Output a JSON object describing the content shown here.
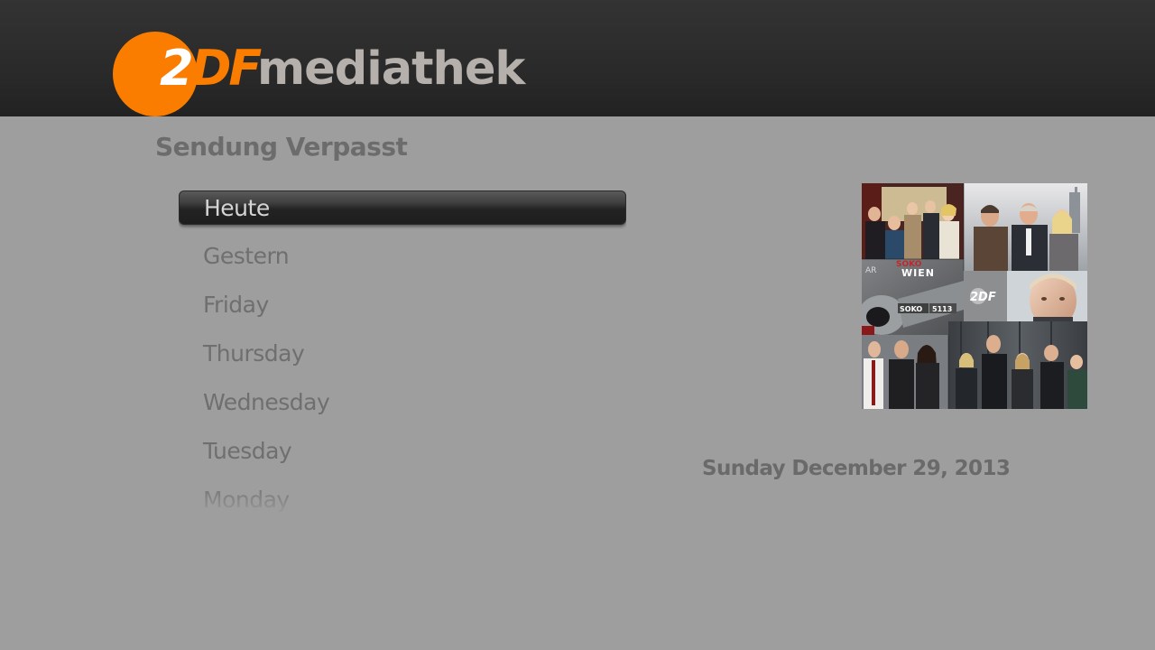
{
  "header": {
    "logo": {
      "zdf_z": "2",
      "zdf_df": "DF",
      "word": "mediathek",
      "circle_color": "#fa7d00",
      "word_color": "#b5b0ab"
    }
  },
  "page": {
    "title": "Sendung Verpasst"
  },
  "menu": {
    "items": [
      {
        "label": "Heute",
        "selected": true
      },
      {
        "label": "Gestern",
        "selected": false
      },
      {
        "label": "Friday",
        "selected": false
      },
      {
        "label": "Thursday",
        "selected": false
      },
      {
        "label": "Wednesday",
        "selected": false
      },
      {
        "label": "Tuesday",
        "selected": false
      },
      {
        "label": "Monday",
        "selected": false
      }
    ]
  },
  "preview": {
    "collage_texts": {
      "soko_wien_top": "SOKO",
      "soko_wien_bottom": "WIEN",
      "soko_5113_left": "SOKO",
      "soko_5113_right": "5113",
      "zdf_small": "2DF",
      "ar": "AR"
    },
    "date": "Sunday December 29, 2013"
  }
}
